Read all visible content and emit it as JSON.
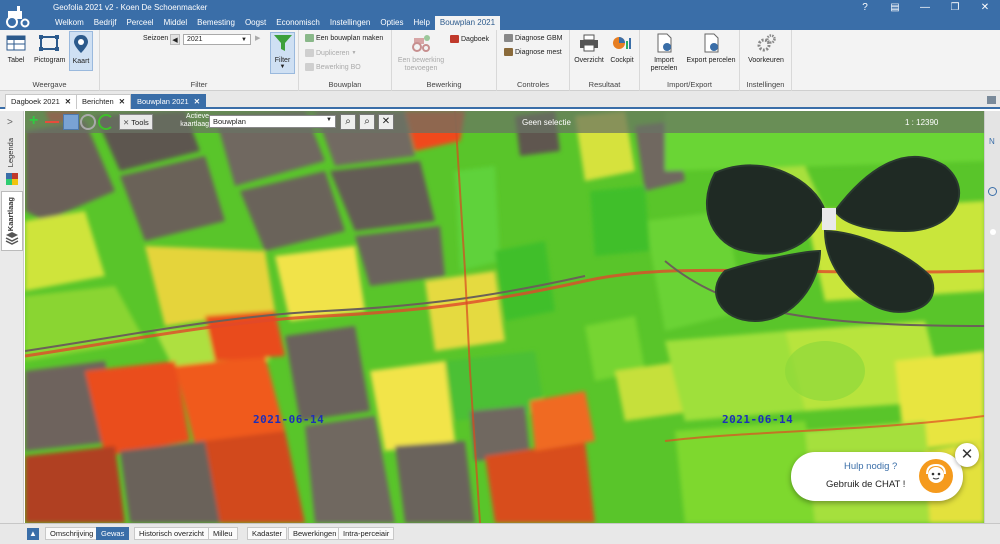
{
  "window": {
    "title": "Geofolia 2021 v2 - Koen De Schoenmacker",
    "controls": [
      "?",
      "▤",
      "—",
      "❐",
      "✕"
    ]
  },
  "menu": [
    "Welkom",
    "Bedrijf",
    "Perceel",
    "Middel",
    "Bemesting",
    "Oogst",
    "Economisch",
    "Instellingen",
    "Opties",
    "Help",
    "Bouwplan 2021"
  ],
  "ribbon": {
    "weergave": {
      "label": "Weergave",
      "tabel": "Tabel",
      "pictogram": "Pictogram",
      "kaart": "Kaart"
    },
    "filter": {
      "label": "Filter",
      "seizoen_label": "Seizoen",
      "seizoen_value": "2021",
      "filter_btn": "Filter"
    },
    "bouwplan": {
      "label": "Bouwplan",
      "maken": "Een bouwplan maken",
      "dupliceren": "Dupliceren",
      "bewerking": "Bewerking BO"
    },
    "bewerking": {
      "label": "Bewerking",
      "toevoegen": "Een bewerking toevoegen",
      "dagboek": "Dagboek"
    },
    "controles": {
      "label": "Controles",
      "gbm": "Diagnose GBM",
      "mest": "Diagnose mest"
    },
    "resultaat": {
      "label": "Resultaat",
      "overzicht": "Overzicht",
      "cockpit": "Cockpit"
    },
    "import_export": {
      "label": "Import/Export",
      "import": "Import percelen",
      "export": "Export percelen"
    },
    "instellingen": {
      "label": "Instellingen",
      "voorkeuren": "Voorkeuren"
    }
  },
  "doc_tabs": [
    {
      "label": "Dagboek 2021",
      "active": false
    },
    {
      "label": "Berichten",
      "active": false
    },
    {
      "label": "Bouwplan 2021",
      "active": true
    }
  ],
  "sidebar": {
    "legenda": "Legenda",
    "kaartlaag": "Kaartlaag"
  },
  "map_toolbar": {
    "tools": "Tools",
    "actieve_kaartlaag": "Actieve kaartlaag",
    "layer_value": "Bouwplan",
    "selection": "Geen selectie",
    "scale": "1 : 12390"
  },
  "map": {
    "date_left": "2021-06-14",
    "date_right": "2021-06-14"
  },
  "chat": {
    "question": "Hulp nodig ?",
    "cta": "Gebruik de CHAT !"
  },
  "bottom_tabs": [
    "Omschrijving",
    "Gewas",
    "Historisch overzicht",
    "Milleu",
    "Kadaster",
    "Bewerkingen",
    "Intra-perceiair"
  ],
  "bottom_active": "Gewas",
  "colors": {
    "brand": "#3a6ea8",
    "chat_avatar": "#f59a1d",
    "date_label": "#1e2fb8"
  }
}
